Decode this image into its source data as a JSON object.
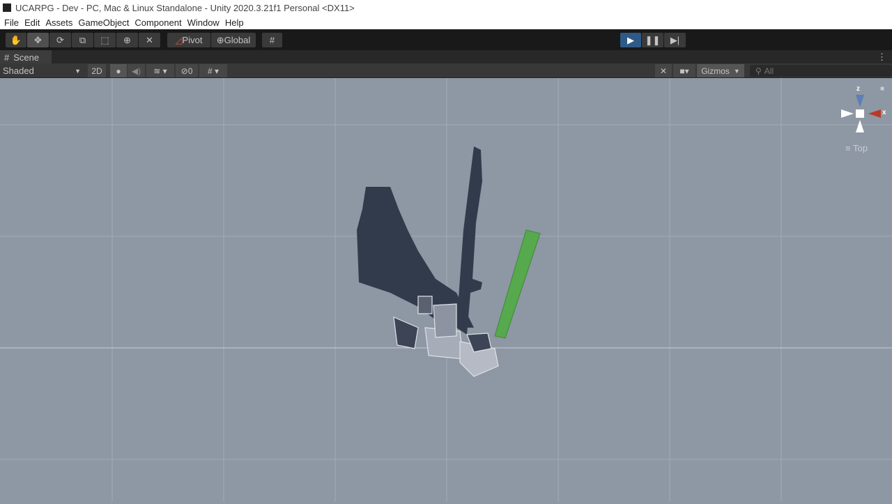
{
  "window": {
    "title": "UCARPG - Dev - PC, Mac & Linux Standalone - Unity 2020.3.21f1 Personal <DX11>"
  },
  "menu": [
    "File",
    "Edit",
    "Assets",
    "GameObject",
    "Component",
    "Window",
    "Help"
  ],
  "toolbar": {
    "pivot": "Pivot",
    "global": "Global"
  },
  "scene_tab": {
    "label": "Scene"
  },
  "scene_toolbar": {
    "shading": "Shaded",
    "mode_2d": "2D",
    "hidden_count": "0",
    "gizmos": "Gizmos",
    "search_placeholder": "All"
  },
  "gizmo": {
    "z": "z",
    "x": "x",
    "view": "Top"
  },
  "colors": {
    "play_active": "#2f5a87",
    "scene_bg": "#8e97a4",
    "x_axis": "#b83a28",
    "z_axis": "#5c7fb5",
    "sword": "#56a94c"
  }
}
